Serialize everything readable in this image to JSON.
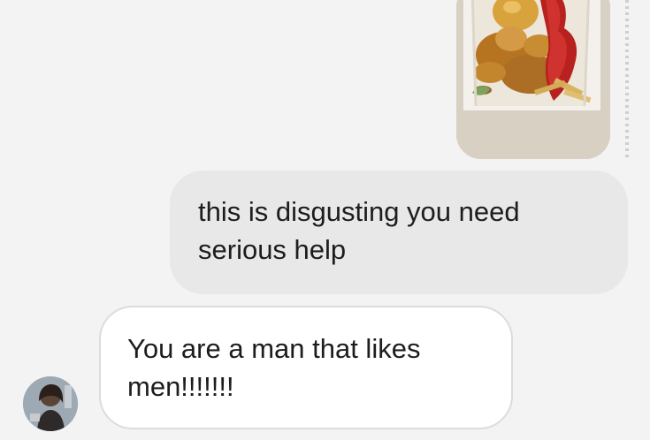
{
  "messages": [
    {
      "type": "image",
      "sender": "me"
    },
    {
      "type": "text",
      "sender": "me",
      "text": "this is disgusting you need serious help"
    },
    {
      "type": "text",
      "sender": "them",
      "text": "You are a man that likes men!!!!!!!"
    }
  ],
  "icons": {
    "avatar": "contact-avatar-icon"
  }
}
